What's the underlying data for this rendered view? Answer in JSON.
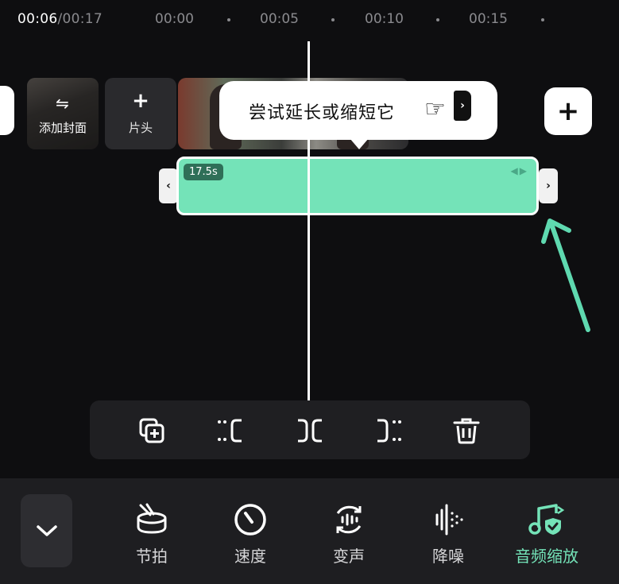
{
  "ruler": {
    "current_time": "00:06",
    "total_time": "/00:17",
    "ticks": [
      "00:00",
      "00:05",
      "00:10",
      "00:15"
    ]
  },
  "thumbnails": {
    "cover_label": "添加封面",
    "head_label": "片头"
  },
  "tooltip": {
    "text": "尝试延长或缩短它"
  },
  "clip": {
    "duration": "17.5s"
  },
  "edit_toolbar": {
    "buttons": [
      "copy-add",
      "trim-left",
      "split",
      "trim-right",
      "delete"
    ]
  },
  "dock": {
    "tools": [
      {
        "label": "节拍",
        "icon": "drum-icon"
      },
      {
        "label": "速度",
        "icon": "speed-dial-icon"
      },
      {
        "label": "变声",
        "icon": "voice-change-icon"
      },
      {
        "label": "降噪",
        "icon": "noise-reduction-icon"
      },
      {
        "label": "音频缩放",
        "icon": "audio-scale-icon",
        "active": true
      }
    ]
  },
  "colors": {
    "accent": "#74e3b8",
    "background": "#0e0e10",
    "dock": "#1e1e21"
  }
}
